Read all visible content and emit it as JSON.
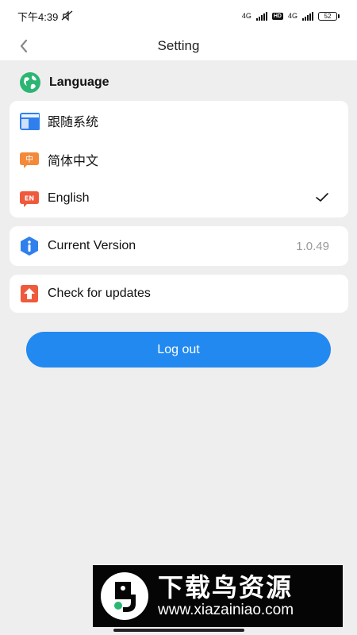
{
  "status_bar": {
    "time": "下午4:39",
    "network_1": "4G",
    "hd_badge": "HD",
    "network_2": "4G",
    "battery": "52"
  },
  "header": {
    "title": "Setting"
  },
  "language_section": {
    "title": "Language",
    "options": [
      {
        "label": "跟随系统",
        "icon": "follow-system-icon",
        "selected": false
      },
      {
        "label": "简体中文",
        "icon": "chinese-badge-icon",
        "badge": "中",
        "selected": false
      },
      {
        "label": "English",
        "icon": "english-badge-icon",
        "badge": "EN",
        "selected": true
      }
    ]
  },
  "version": {
    "label": "Current Version",
    "value": "1.0.49"
  },
  "updates": {
    "label": "Check for updates"
  },
  "logout": {
    "label": "Log out"
  },
  "watermark": {
    "title": "下载鸟资源",
    "url": "www.xiazainiao.com"
  },
  "colors": {
    "accent": "#2289f0",
    "orange": "#f28a3a",
    "red_orange": "#ef5a3c",
    "globe_green": "#2bb673",
    "info_blue": "#2f80ed",
    "background": "#eeeeee"
  }
}
